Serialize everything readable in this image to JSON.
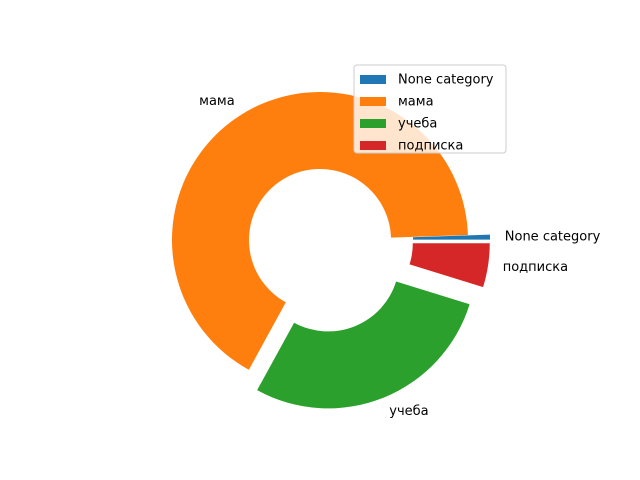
{
  "chart_data": {
    "type": "donut",
    "slices": [
      {
        "label": "None category",
        "value": 0.5,
        "color": "#1f77b4",
        "exploded": true
      },
      {
        "label": "мама",
        "value": 62.5,
        "color": "#ff7f0e",
        "exploded": false
      },
      {
        "label": "учеба",
        "value": 26.5,
        "color": "#2ca02c",
        "exploded": true
      },
      {
        "label": "подписка",
        "value": 4.5,
        "color": "#d62728",
        "exploded": true
      }
    ],
    "start_angle_deg": 0,
    "direction": "counterclockwise",
    "inner_radius_ratio": 0.48,
    "legend": {
      "position": "upper-right",
      "entries": [
        "None category",
        "мама",
        "учеба",
        "подписка"
      ]
    }
  }
}
